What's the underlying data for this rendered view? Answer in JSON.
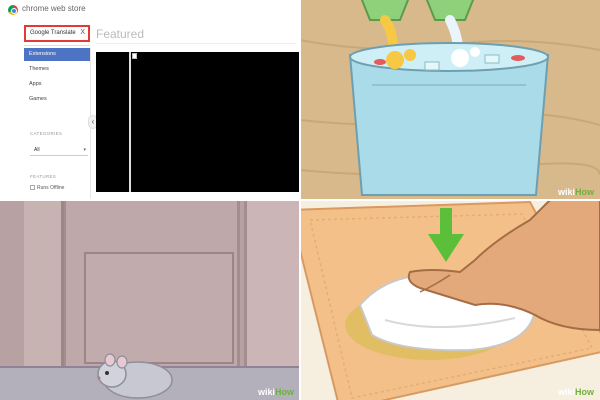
{
  "tile1": {
    "store_title": "chrome web store",
    "search_value": "Google Translate",
    "search_clear": "X",
    "nav": [
      "Extensions",
      "Themes",
      "Apps",
      "Games"
    ],
    "main_title": "Featured",
    "categories_label": "CATEGORIES",
    "category_value": "All",
    "features_label": "FEATURES",
    "feature_option": "Runs Offline",
    "collapse_glyph": "‹"
  },
  "tile2": {
    "wiki_left": "wiki",
    "wiki_right": "How"
  },
  "tile3": {
    "wiki_left": "wiki",
    "wiki_right": "How"
  },
  "tile4": {
    "wiki_left": "wiki",
    "wiki_right": "How"
  },
  "colors": {
    "search_highlight": "#e53935",
    "nav_active": "#4d73c4",
    "arrow_green": "#5bbf3a",
    "wikihow_green": "#6fb23a"
  }
}
